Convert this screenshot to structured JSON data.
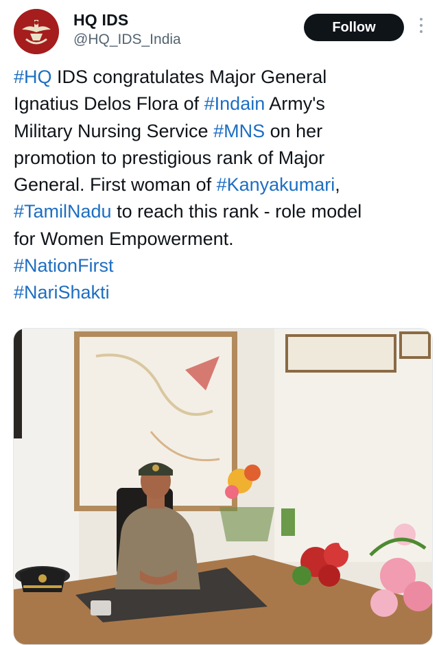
{
  "account": {
    "name": "HQ IDS",
    "handle": "@HQ_IDS_India",
    "avatar_icon": "emblem-icon"
  },
  "actions": {
    "follow_label": "Follow",
    "more_icon": "more-vertical-icon"
  },
  "tweet": {
    "l1": {
      "t1": "#HQ",
      "t2": " IDS congratulates Major General"
    },
    "l2": {
      "t1": "Ignatius Delos Flora of ",
      "t2": "#Indain",
      "t3": " Army's"
    },
    "l3": {
      "t1": "Military Nursing Service ",
      "t2": "#MNS",
      "t3": " on her"
    },
    "l4": {
      "t1": "promotion to prestigious rank of Major"
    },
    "l5": {
      "t1": "General. First woman of ",
      "t2": "#Kanyakumari",
      "t3": ","
    },
    "l6": {
      "t1": "#TamilNadu",
      "t2": " to reach this rank - role model"
    },
    "l7": {
      "t1": "for Women Empowerment."
    },
    "l8": {
      "t1": "#NationFirst"
    },
    "l9": {
      "t1": "#NariShakti"
    }
  },
  "colors": {
    "hashtag": "#1d6ec2",
    "text": "#0f1419",
    "secondary": "#536471",
    "follow_bg": "#0f1419",
    "emblem_bg": "#a51d1d"
  },
  "media": {
    "icon": "photo-icon"
  }
}
